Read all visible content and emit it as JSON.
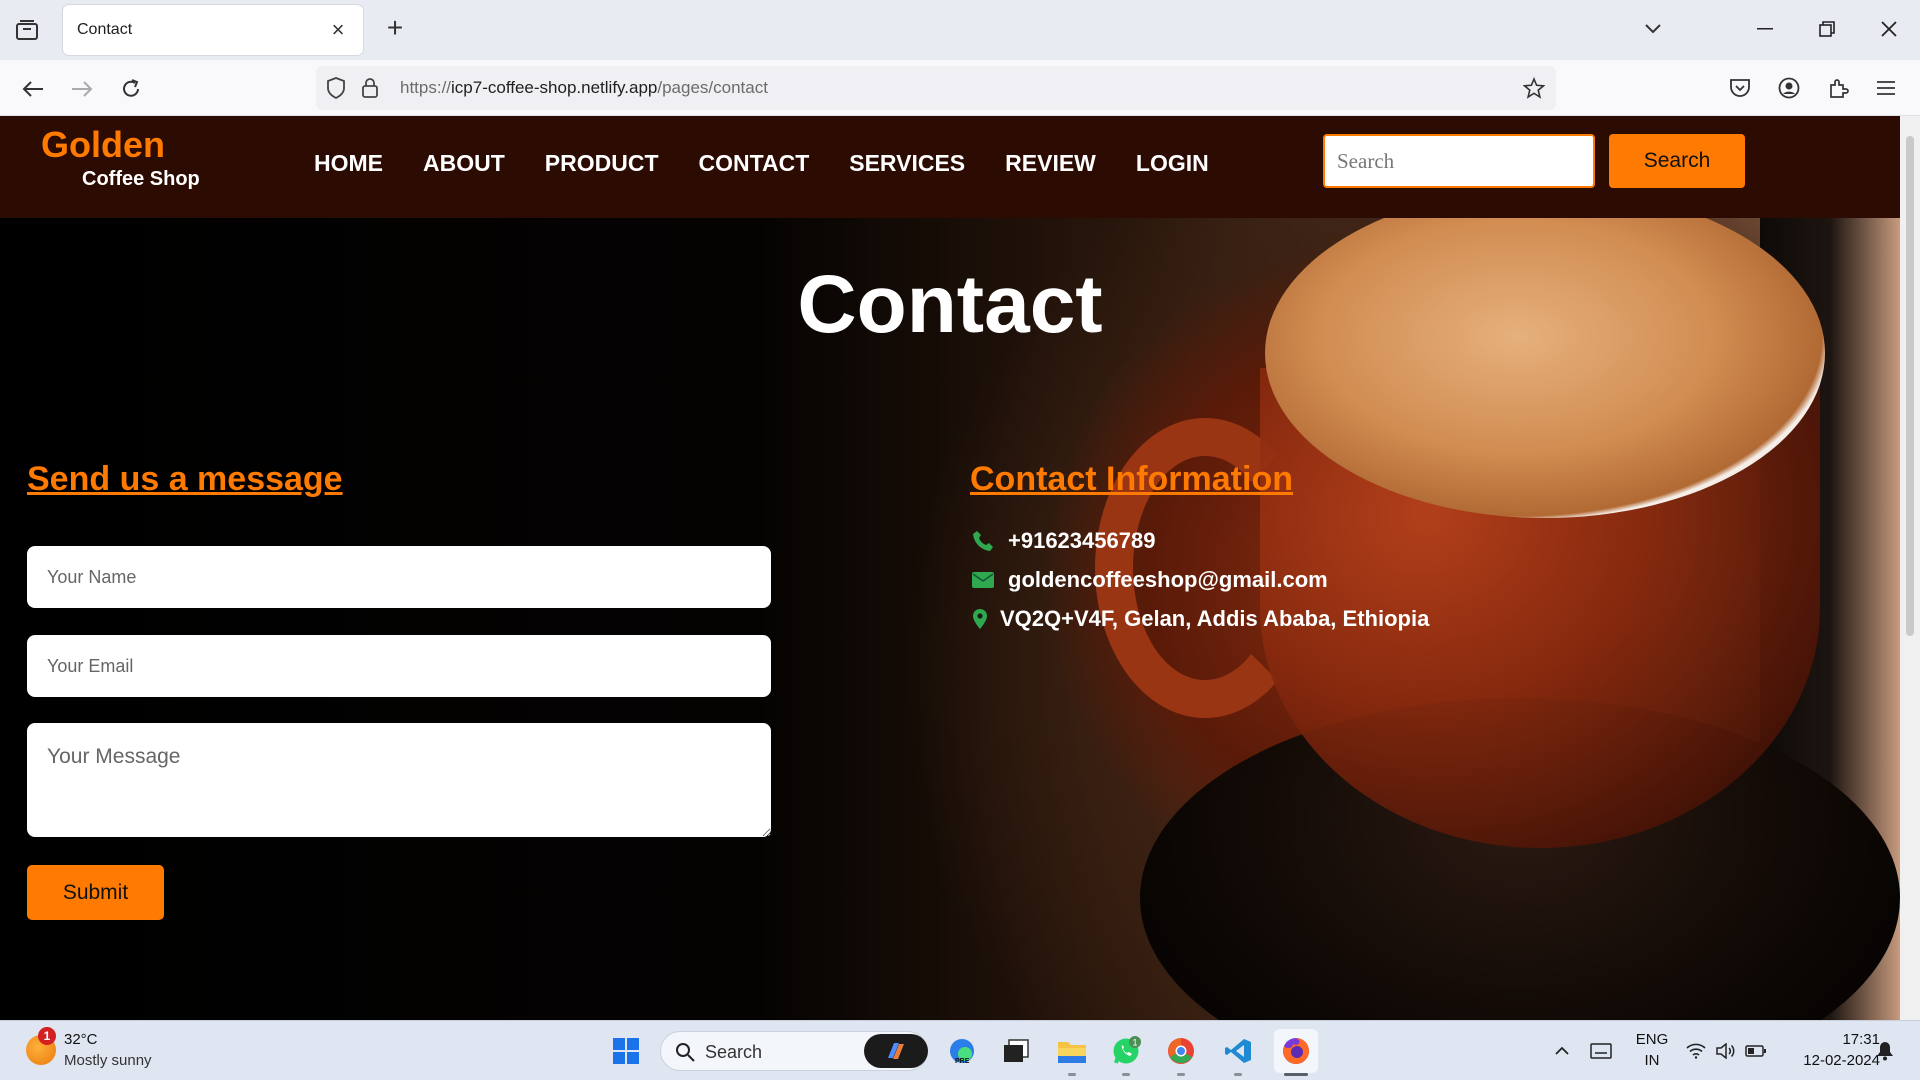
{
  "browser": {
    "tab_title": "Contact",
    "tab_close": "×",
    "new_tab": "+",
    "url_prefix": "https://",
    "url_domain": "icp7-coffee-shop.netlify.app",
    "url_path": "/pages/contact"
  },
  "site": {
    "logo_top": "Golden",
    "logo_bottom": "Coffee Shop",
    "menu": [
      "HOME",
      "ABOUT",
      "PRODUCT",
      "CONTACT",
      "SERVICES",
      "REVIEW",
      "LOGIN"
    ],
    "search_placeholder": "Search",
    "search_button": "Search"
  },
  "contact": {
    "title": "Contact",
    "form_heading": "Send us a message",
    "name_placeholder": "Your Name",
    "email_placeholder": "Your Email",
    "message_placeholder": "Your Message",
    "submit_label": "Submit",
    "info_heading": "Contact Information",
    "phone": "+91623456789",
    "email": "goldencoffeeshop@gmail.com",
    "address": "VQ2Q+V4F, Gelan, Addis Ababa, Ethiopia",
    "accent_color": "#ff7a00",
    "icon_color": "#2fa84f"
  },
  "taskbar": {
    "weather_temp": "32°C",
    "weather_desc": "Mostly sunny",
    "weather_badge": "1",
    "search_label": "Search",
    "whatsapp_badge": "1",
    "lang_top": "ENG",
    "lang_bottom": "IN",
    "time": "17:31",
    "date": "12-02-2024"
  }
}
